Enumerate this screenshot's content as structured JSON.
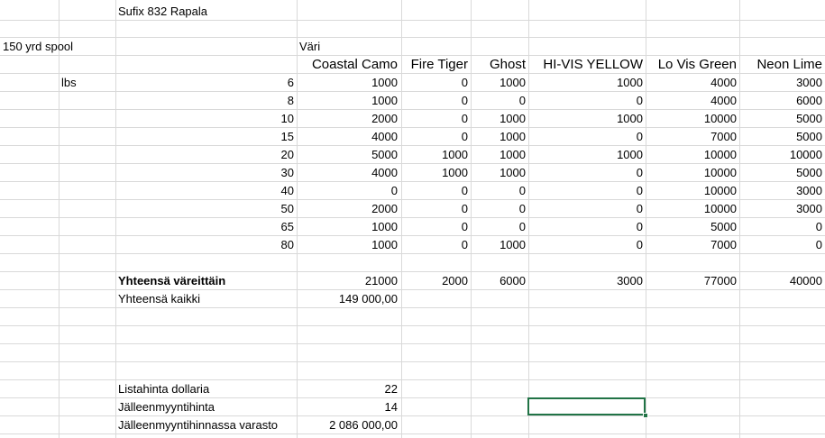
{
  "sheet": {
    "title": "Sufix 832 Rapala",
    "spool_label": "150 yrd  spool",
    "color_label": "Väri",
    "unit_label": "lbs",
    "colors": [
      "Coastal Camo",
      "Fire Tiger",
      "Ghost",
      "HI-VIS YELLOW",
      "Lo Vis Green",
      "Neon Lime"
    ],
    "rows": [
      {
        "lbs": "6",
        "values": [
          "1000",
          "0",
          "1000",
          "1000",
          "4000",
          "3000"
        ]
      },
      {
        "lbs": "8",
        "values": [
          "1000",
          "0",
          "0",
          "0",
          "4000",
          "6000"
        ]
      },
      {
        "lbs": "10",
        "values": [
          "2000",
          "0",
          "1000",
          "1000",
          "10000",
          "5000"
        ]
      },
      {
        "lbs": "15",
        "values": [
          "4000",
          "0",
          "1000",
          "0",
          "7000",
          "5000"
        ]
      },
      {
        "lbs": "20",
        "values": [
          "5000",
          "1000",
          "1000",
          "1000",
          "10000",
          "10000"
        ]
      },
      {
        "lbs": "30",
        "values": [
          "4000",
          "1000",
          "1000",
          "0",
          "10000",
          "5000"
        ]
      },
      {
        "lbs": "40",
        "values": [
          "0",
          "0",
          "0",
          "0",
          "10000",
          "3000"
        ]
      },
      {
        "lbs": "50",
        "values": [
          "2000",
          "0",
          "0",
          "0",
          "10000",
          "3000"
        ]
      },
      {
        "lbs": "65",
        "values": [
          "1000",
          "0",
          "0",
          "0",
          "5000",
          "0"
        ]
      },
      {
        "lbs": "80",
        "values": [
          "1000",
          "0",
          "1000",
          "0",
          "7000",
          "0"
        ]
      }
    ],
    "totals_label": "Yhteensä väreittäin",
    "totals": [
      "21000",
      "2000",
      "6000",
      "3000",
      "77000",
      "40000"
    ],
    "grand_total_label": "Yhteensä kaikki",
    "grand_total": "149 000,00",
    "list_price_label": "Listahinta dollaria",
    "list_price": "22",
    "resale_price_label": "Jälleenmyyntihinta",
    "resale_price": "14",
    "stock_value_label": "Jälleenmyyntihinnassa varasto",
    "stock_value": "2 086 000,00"
  }
}
